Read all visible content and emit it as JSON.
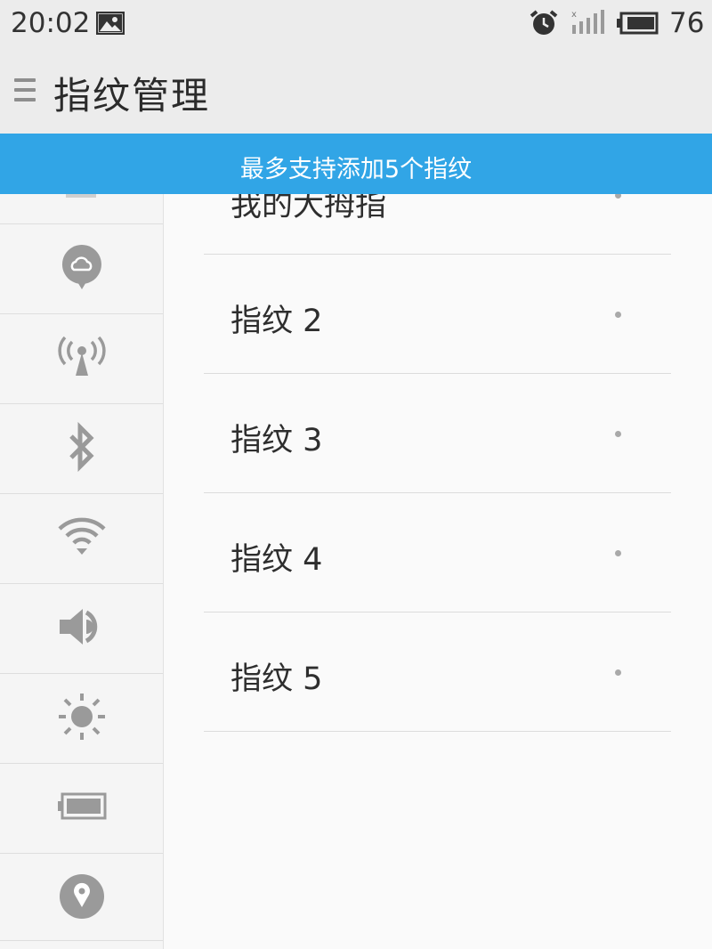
{
  "status_bar": {
    "time": "20:02",
    "battery_level": "76",
    "icons": [
      "image-icon",
      "alarm-icon",
      "signal-icon",
      "battery-icon"
    ]
  },
  "header": {
    "title": "指纹管理",
    "menu_icon": "menu-icon"
  },
  "banner": {
    "text": "最多支持添加5个指纹",
    "color": "#31a5e6"
  },
  "sidebar": {
    "items": [
      {
        "icon": "cloud-icon"
      },
      {
        "icon": "hotspot-icon"
      },
      {
        "icon": "bluetooth-icon"
      },
      {
        "icon": "wifi-icon"
      },
      {
        "icon": "volume-icon"
      },
      {
        "icon": "brightness-icon"
      },
      {
        "icon": "battery-icon"
      },
      {
        "icon": "location-icon"
      }
    ]
  },
  "fingerprints": [
    {
      "label": "我的大拇指"
    },
    {
      "label": "指纹 2"
    },
    {
      "label": "指纹 3"
    },
    {
      "label": "指纹 4"
    },
    {
      "label": "指纹 5"
    }
  ]
}
